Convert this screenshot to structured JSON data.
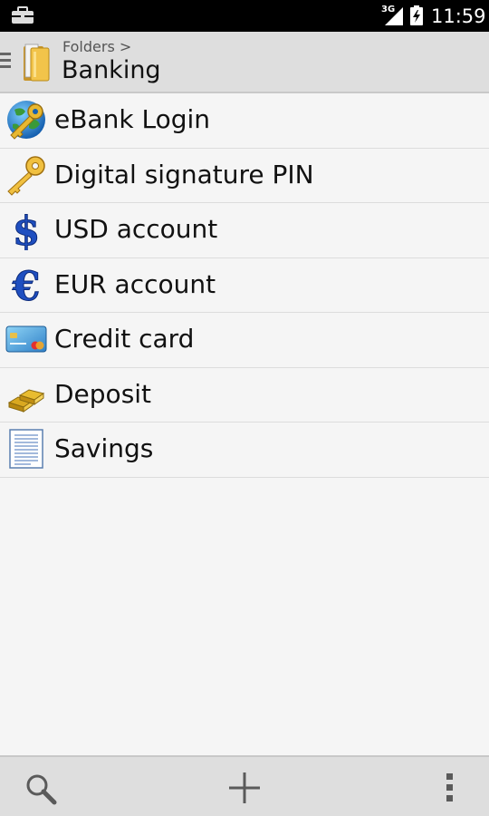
{
  "status_bar": {
    "network": "3G",
    "time": "11:59"
  },
  "header": {
    "breadcrumb": "Folders >",
    "title": "Banking"
  },
  "items": [
    {
      "label": "eBank Login",
      "icon": "globe-key-icon"
    },
    {
      "label": "Digital signature PIN",
      "icon": "key-icon"
    },
    {
      "label": "USD account",
      "icon": "dollar-icon"
    },
    {
      "label": "EUR account",
      "icon": "euro-icon"
    },
    {
      "label": "Credit card",
      "icon": "credit-card-icon"
    },
    {
      "label": "Deposit",
      "icon": "gold-bars-icon"
    },
    {
      "label": "Savings",
      "icon": "document-icon"
    }
  ],
  "bottom_bar": {
    "icons": [
      "search-icon",
      "add-icon",
      "overflow-menu-icon"
    ]
  },
  "colors": {
    "status_bar": "#000000",
    "action_bar": "#dedede",
    "background": "#f5f5f5",
    "divider": "#dcdcdc"
  }
}
